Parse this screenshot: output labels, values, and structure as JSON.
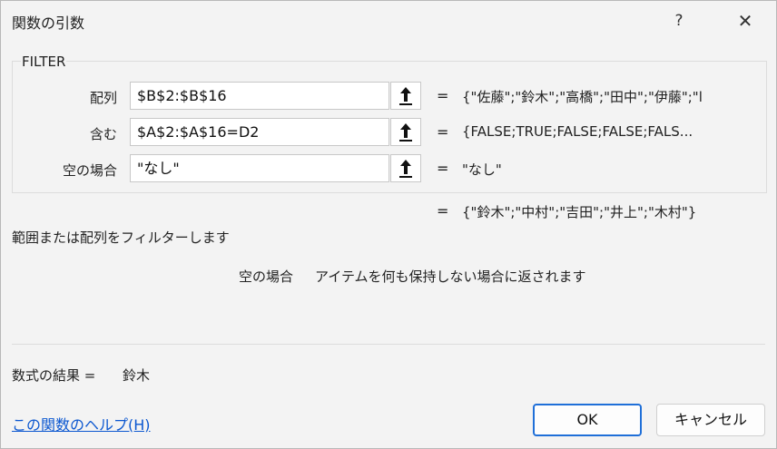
{
  "window": {
    "title": "関数の引数",
    "help_label": "?",
    "close_label": "✕"
  },
  "function": {
    "name": "FILTER",
    "arguments": [
      {
        "label": "配列",
        "input": "$B$2:$B$16",
        "value": "{\"佐藤\";\"鈴木\";\"高橋\";\"田中\";\"伊藤\";\"l"
      },
      {
        "label": "含む",
        "input": "$A$2:$A$16=D2",
        "value": "{FALSE;TRUE;FALSE;FALSE;FALS..."
      },
      {
        "label": "空の場合",
        "input": "\"なし\"",
        "value": "\"なし\""
      }
    ],
    "equals": "=",
    "result_preview": "{\"鈴木\";\"中村\";\"吉田\";\"井上\";\"木村\"}",
    "description": "範囲または配列をフィルターします",
    "arg_help_name": "空の場合",
    "arg_help_text": "アイテムを何も保持しない場合に返されます"
  },
  "formula_result": {
    "label": "数式の結果 =",
    "value": "鈴木"
  },
  "footer": {
    "help_link": "この関数のヘルプ(H)",
    "ok_label": "OK",
    "cancel_label": "キャンセル"
  },
  "icons": {
    "ref": "upload-arrow-icon"
  }
}
